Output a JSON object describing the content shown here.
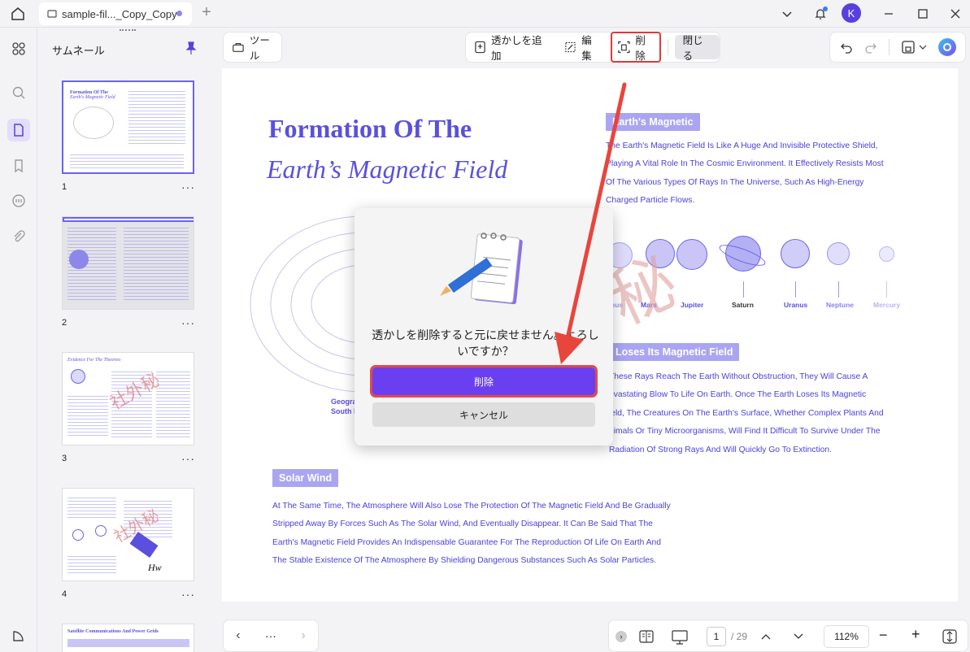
{
  "titlebar": {
    "tab_title": "sample-fil..._Copy_Copy",
    "avatar_letter": "K"
  },
  "sidebar": {
    "panel_title": "サムネール",
    "pages": [
      "1",
      "2",
      "3",
      "4"
    ],
    "more": "···"
  },
  "toolbar": {
    "tools_label": "ツール",
    "add_watermark": "透かしを追加",
    "edit": "編集",
    "delete": "削除",
    "close": "閉じる"
  },
  "document": {
    "title_line1": "Formation Of The",
    "title_line2": "Earth’s Magnetic Field",
    "section1_heading": "Earth's Magnetic",
    "section1_lines": [
      "The Earth's Magnetic Field Is Like A Huge And Invisible Protective Shield,",
      "Playing A Vital Role In The Cosmic Environment. It Effectively Resists Most",
      "Of The Various Types Of Rays In The Universe, Such As High-Energy",
      "Charged Particle Flows."
    ],
    "planets": [
      "nus",
      "Mars",
      "Jupiter",
      "Saturn",
      "Uranus",
      "Neptune",
      "Mercury"
    ],
    "section2_heading": "Loses Its Magnetic Field",
    "section2_lines": [
      "These Rays Reach The Earth Without Obstruction, They Will Cause A",
      "evastating Blow To Life On Earth. Once The Earth Loses Its Magnetic",
      "ield, The Creatures On The Earth's Surface, Whether Complex Plants And",
      "nimals Or Tiny Microorganisms, Will Find It Difficult To Survive Under The",
      "Radiation Of Strong Rays And Will Quickly Go To Extinction."
    ],
    "geo_label1": "Geogra",
    "geo_label2": "South P",
    "section3_heading": "Solar Wind",
    "section3_lines": [
      "At The Same Time, The Atmosphere Will Also Lose The Protection Of The Magnetic Field And Be Gradually",
      "Stripped Away By Forces Such As The Solar Wind, And Eventually Disappear. It Can Be Said That The",
      "Earth's Magnetic Field Provides An Indispensable Guarantee For The Reproduction Of Life On Earth And",
      "The Stable Existence Of The Atmosphere By Shielding Dangerous Substances Such As Solar Particles."
    ],
    "watermark_text": "秘"
  },
  "dialog": {
    "message": "透かしを削除すると元に戻せません。よろしいですか？",
    "delete_label": "削除",
    "cancel_label": "キャンセル"
  },
  "bottombar": {
    "more": "···",
    "current_page": "1",
    "total_pages": "/ 29",
    "zoom": "112%"
  },
  "colors": {
    "accent": "#6a3ff0",
    "doc_text": "#4a42d8",
    "highlight": "#e03a3a"
  }
}
